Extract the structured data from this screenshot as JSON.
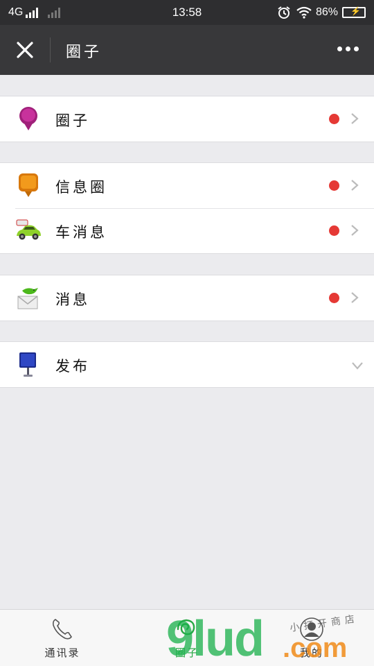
{
  "status_bar": {
    "network": "4G",
    "time": "13:58",
    "battery_percent": "86%",
    "icons": [
      "signal-icon",
      "alarm-icon",
      "wifi-icon",
      "battery-charging-icon"
    ]
  },
  "header": {
    "title": "圈子",
    "close_icon": "close-icon",
    "more_icon": "more-dots-icon"
  },
  "groups": [
    {
      "items": [
        {
          "label": "圈子",
          "icon": "purple-pin-icon",
          "badge": true
        }
      ]
    },
    {
      "items": [
        {
          "label": "信息圈",
          "icon": "orange-pin-icon",
          "badge": true
        },
        {
          "label": "车消息",
          "icon": "green-car-icon",
          "badge": true
        }
      ]
    },
    {
      "items": [
        {
          "label": "消息",
          "icon": "envelope-bird-icon",
          "badge": true
        }
      ]
    },
    {
      "items": [
        {
          "label": "发布",
          "icon": "blue-sign-icon",
          "expand": "chevron-down-icon"
        }
      ]
    }
  ],
  "tab_bar": {
    "tabs": [
      {
        "label": "通讯录",
        "icon": "phone-icon",
        "active": false
      },
      {
        "label": "圈子",
        "icon": "circle-swirl-icon",
        "active": true
      },
      {
        "label": "我的",
        "icon": "user-avatar-icon",
        "active": false
      }
    ]
  },
  "watermark": {
    "logo_text": "9lud",
    "suffix": ".com",
    "overlay_text": "小打开商店"
  },
  "colors": {
    "header_bg": "#38383a",
    "badge_red": "#e53935",
    "active_tab": "#27a844",
    "page_bg": "#ebebee"
  }
}
